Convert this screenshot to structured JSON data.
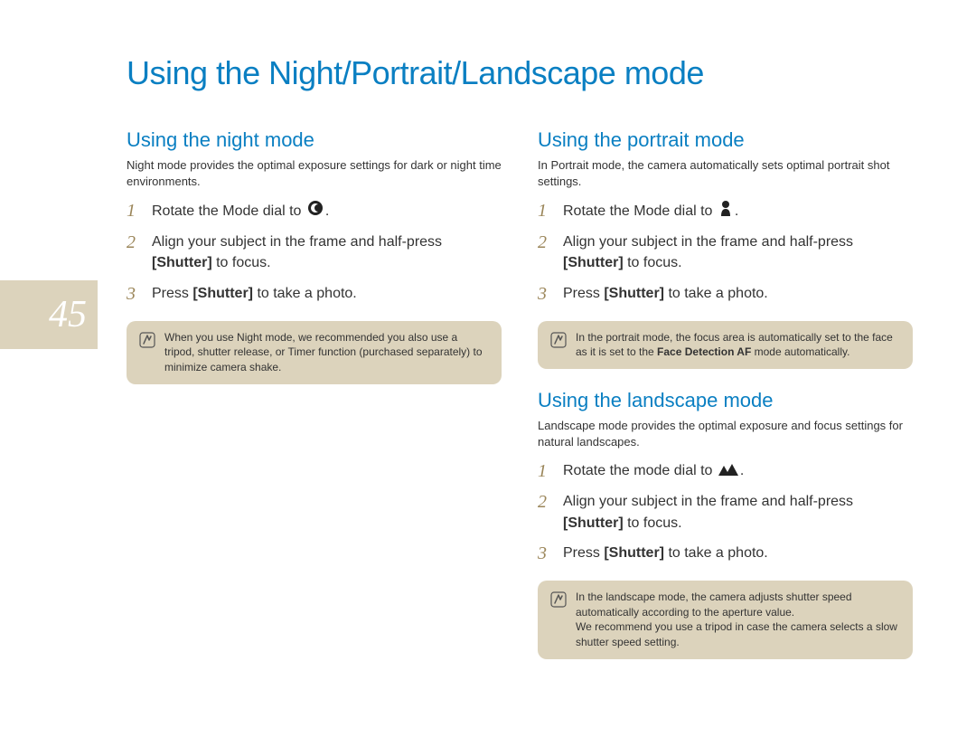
{
  "pageNumber": "45",
  "title": "Using the Night/Portrait/Landscape mode",
  "left": {
    "night": {
      "heading": "Using the night mode",
      "intro": "Night mode provides the optimal exposure settings for dark or night time environments.",
      "steps": [
        {
          "num": "1",
          "pre": "Rotate the Mode dial to ",
          "icon": "night-icon",
          "post": "."
        },
        {
          "num": "2",
          "pre": "Align your subject in the frame and half-press ",
          "bold": "[Shutter]",
          "post": " to focus."
        },
        {
          "num": "3",
          "pre": "Press ",
          "bold": "[Shutter]",
          "post": " to take a photo."
        }
      ],
      "note": "When you use Night mode, we recommended you also use a tripod, shutter release, or Timer function (purchased separately) to minimize camera shake."
    }
  },
  "right": {
    "portrait": {
      "heading": "Using the portrait mode",
      "intro": "In Portrait mode, the camera automatically sets optimal portrait shot settings.",
      "steps": [
        {
          "num": "1",
          "pre": "Rotate the Mode dial to ",
          "icon": "portrait-icon",
          "post": "."
        },
        {
          "num": "2",
          "pre": "Align your subject in the frame and half-press ",
          "bold": "[Shutter]",
          "post": " to focus."
        },
        {
          "num": "3",
          "pre": "Press ",
          "bold": "[Shutter]",
          "post": " to take a photo."
        }
      ],
      "note_pre": "In the portrait mode, the focus area is automatically set to the face as it is set to the ",
      "note_bold": "Face Detection AF",
      "note_post": " mode automatically."
    },
    "landscape": {
      "heading": "Using the landscape mode",
      "intro": "Landscape mode provides the optimal exposure and focus settings for natural landscapes.",
      "steps": [
        {
          "num": "1",
          "pre": "Rotate the mode dial to ",
          "icon": "landscape-icon",
          "post": "."
        },
        {
          "num": "2",
          "pre": "Align your subject in the frame and half-press ",
          "bold": "[Shutter]",
          "post": " to focus."
        },
        {
          "num": "3",
          "pre": "Press ",
          "bold": "[Shutter]",
          "post": " to take a photo."
        }
      ],
      "note": "In the landscape mode, the camera adjusts shutter speed automatically according to the aperture value.\nWe recommend you use a tripod in case the camera selects a slow shutter speed setting."
    }
  }
}
